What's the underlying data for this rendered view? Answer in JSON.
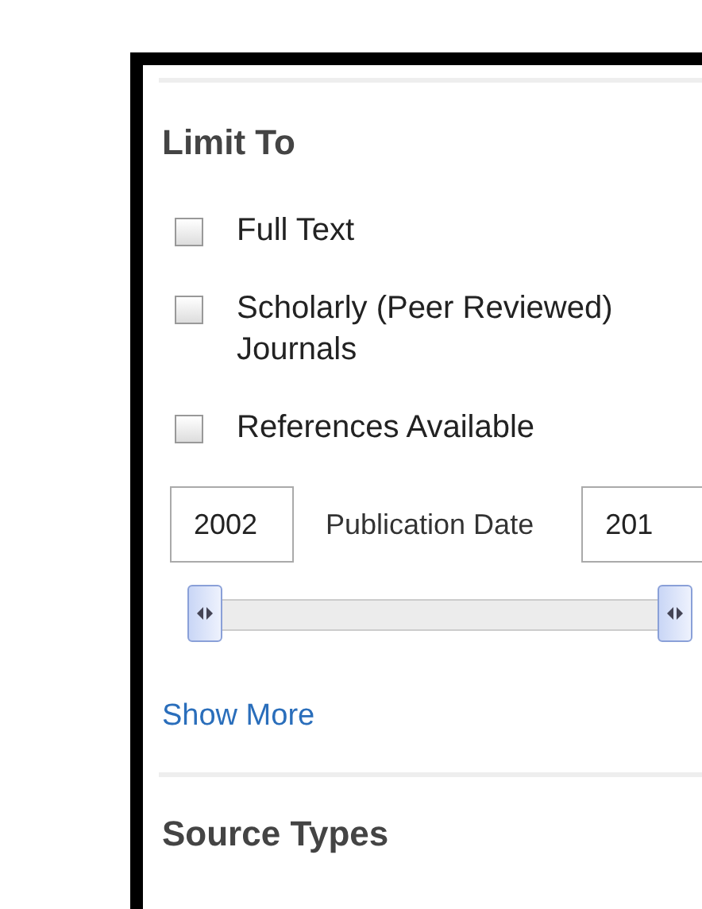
{
  "section": {
    "title": "Limit To"
  },
  "limits": [
    {
      "label": "Full Text",
      "checked": false
    },
    {
      "label": "Scholarly (Peer Reviewed) Journals",
      "checked": false
    },
    {
      "label": "References Available",
      "checked": false
    }
  ],
  "date_range": {
    "from": "2002",
    "label": "Publication Date",
    "to": "201",
    "thumbs": [
      {
        "level": 0
      },
      {
        "level": 1
      }
    ]
  },
  "show_more": "Show More",
  "next_section": {
    "title": "Source Types"
  }
}
